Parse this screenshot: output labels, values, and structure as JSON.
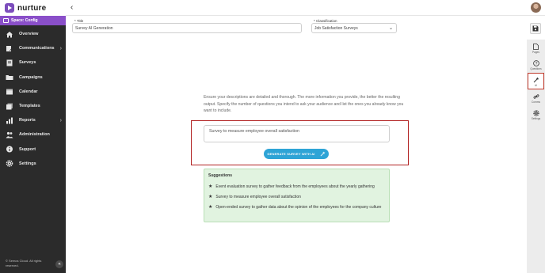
{
  "app": {
    "name": "nurture"
  },
  "sidebar": {
    "space_label": "Space: Config",
    "items": [
      {
        "label": "Overview",
        "icon": "home-icon",
        "chevron": false
      },
      {
        "label": "Communications",
        "icon": "pencil-icon",
        "chevron": true
      },
      {
        "label": "Surveys",
        "icon": "document-icon",
        "chevron": false
      },
      {
        "label": "Campaigns",
        "icon": "folder-icon",
        "chevron": false
      },
      {
        "label": "Calendar",
        "icon": "calendar-icon",
        "chevron": false
      },
      {
        "label": "Templates",
        "icon": "templates-icon",
        "chevron": false
      },
      {
        "label": "Reports",
        "icon": "chart-icon",
        "chevron": true
      },
      {
        "label": "Administration",
        "icon": "people-icon",
        "chevron": false
      },
      {
        "label": "Support",
        "icon": "info-icon",
        "chevron": false
      },
      {
        "label": "Settings",
        "icon": "gear-icon",
        "chevron": false
      }
    ],
    "footer": "© Semos Cloud. All rights reserved."
  },
  "form": {
    "title_label": "* Title",
    "title_value": "Survey AI Generation",
    "classification_label": "* Classification",
    "classification_value": "Job Satisfaction Surveys"
  },
  "right_panel": {
    "items": [
      {
        "label": "Pages",
        "icon": "page-icon"
      },
      {
        "label": "Questions",
        "icon": "question-icon"
      },
      {
        "label": "AI",
        "icon": "magic-wand-icon",
        "highlighted": true
      },
      {
        "label": "Comms",
        "icon": "link-icon"
      },
      {
        "label": "Settings",
        "icon": "gear-icon"
      }
    ]
  },
  "main": {
    "description": "Ensure your descriptions are detailed and thorough. The more information you provide, the better the resulting output. Specify the number of questions you intend to ask your audience and list the ones you already know you want to include.",
    "prompt_value": "Survey to measure employee overall satisfaction",
    "generate_button": "GENERATE SURVEY WITH AI",
    "suggestions_title": "Suggestions",
    "suggestions": [
      "Event evaluation survey to gather feedback from the employees about the yearly gathering",
      "Survey to measure employee overall satisfaction",
      "Open-ended survey to gather data about the opinion of the employees for the company culture"
    ]
  },
  "colors": {
    "sidebar_bg": "#2b2b2b",
    "space_bar": "#8a4fc9",
    "accent_button": "#2ea4d6",
    "suggestion_bg": "#e1f3e0",
    "highlight_border": "#b22222"
  }
}
